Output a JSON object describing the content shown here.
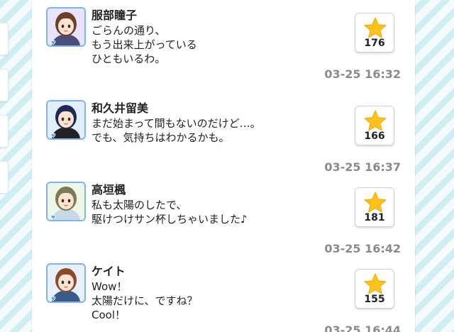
{
  "posts": [
    {
      "name": "服部瞳子",
      "lines": [
        "ごらんの通り、",
        "もう出来上がっている",
        "ひともいるわ。"
      ],
      "likes": "176",
      "time": "03-25 16:32",
      "avatar": {
        "hair": "#6b3f2a",
        "bg": "#e9e3ff",
        "outfit": "#4a4f7a"
      }
    },
    {
      "name": "和久井留美",
      "lines": [
        "まだ始まって間もないのだけど…。",
        "でも、気持ちはわかるかも。"
      ],
      "likes": "166",
      "time": "03-25 16:37",
      "avatar": {
        "hair": "#1d2a55",
        "bg": "#e2eeff",
        "outfit": "#222222"
      }
    },
    {
      "name": "高垣楓",
      "lines": [
        "私も太陽のしたで、",
        "駆けつけサン杯しちゃいました♪"
      ],
      "likes": "181",
      "time": "03-25 16:42",
      "avatar": {
        "hair": "#7c7a55",
        "bg": "#eef6e6",
        "outfit": "#c9d8e6"
      }
    },
    {
      "name": "ケイト",
      "lines": [
        "Wow！",
        "太陽だけに、ですね？",
        "Cool！"
      ],
      "likes": "155",
      "time": "03-25 16:44",
      "avatar": {
        "hair": "#8a4b2a",
        "bg": "#e8f0ff",
        "outfit": "#3a5a8a"
      }
    }
  ],
  "icons": {
    "like": "star-icon",
    "avatar_badge": "heart-icon"
  },
  "colors": {
    "star": "#ffc21a",
    "timestamp": "#8a8a8a",
    "avatar_border": "#7fb3ec",
    "background_stripe": "#cfeef3"
  }
}
